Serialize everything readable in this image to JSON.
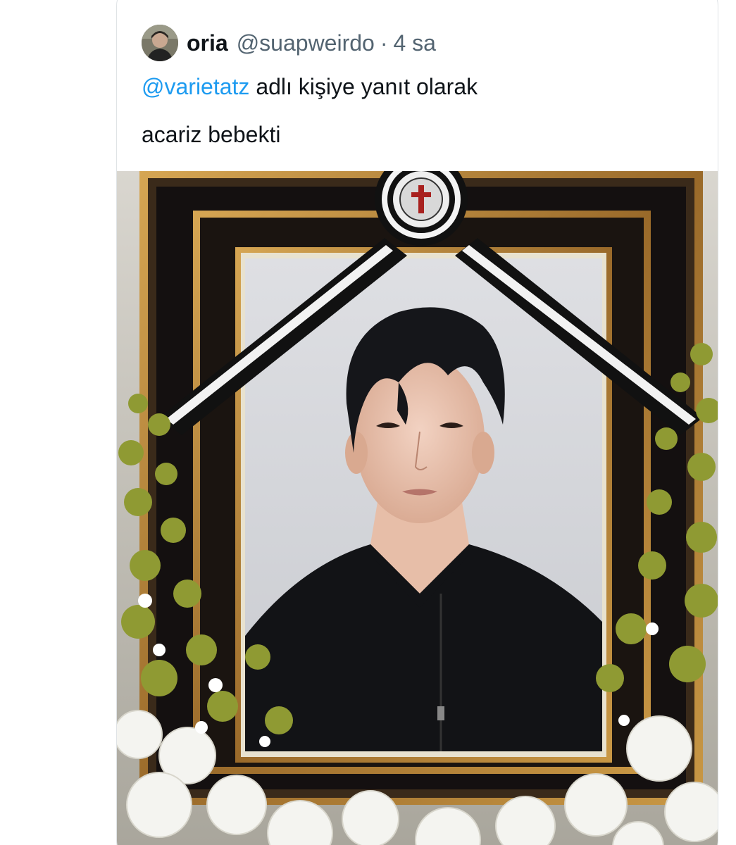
{
  "tweet": {
    "author": {
      "display_name": "oria",
      "handle": "@suapweirdo",
      "separator": "·",
      "time": "4 sa"
    },
    "reply_context": {
      "mention": "@varietatz",
      "suffix": " adlı kişiye yanıt olarak"
    },
    "text": "acariz bebekti",
    "media": {
      "description_icon": "memorial-portrait-photo",
      "colors": {
        "frame_gold": "#b8893c",
        "frame_dark": "#2a1e14",
        "ribbon_black": "#111111",
        "portrait_bg": "#d6d8dc",
        "foliage": "#9aa63a",
        "flowers": "#f4f4f0"
      }
    }
  },
  "colors": {
    "link_blue": "#1d9bf0",
    "text_primary": "#0f1419",
    "text_secondary": "#536471",
    "card_border": "#dfe3e6"
  }
}
